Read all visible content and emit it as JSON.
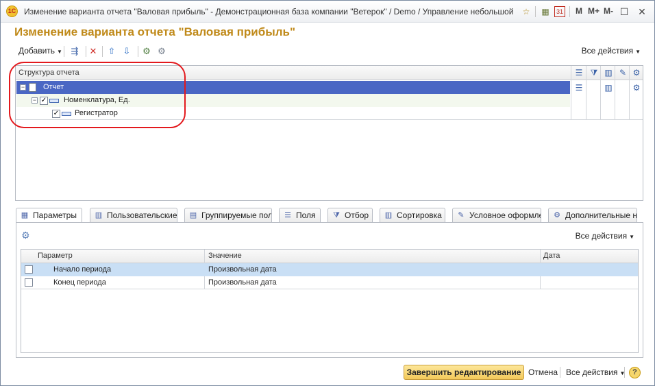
{
  "window": {
    "app_logo": "1С",
    "title": "Изменение варианта отчета \"Валовая прибыль\" - Демонстрационная база компании \"Ветерок\" / Demo / Управление небольшой фирмой,...",
    "title_buttons": {
      "m": "M",
      "m_plus": "M+",
      "m_minus": "M-",
      "minimize": "—",
      "maximize": "☐",
      "close": "✕"
    },
    "calendar_day": "31"
  },
  "page": {
    "title": "Изменение варианта отчета \"Валовая прибыль\""
  },
  "toolbar": {
    "add_label": "Добавить",
    "all_actions": "Все действия"
  },
  "structure": {
    "header": "Структура отчета",
    "rows": [
      {
        "label": "Отчет",
        "level": 0,
        "checked": null,
        "selected": true
      },
      {
        "label": "Номенклатура, Ед.",
        "level": 1,
        "checked": true,
        "selected": false
      },
      {
        "label": "Регистратор",
        "level": 2,
        "checked": true,
        "selected": false
      }
    ]
  },
  "tabs": [
    {
      "label": "Параметры",
      "active": true,
      "icon": "params-icon"
    },
    {
      "label": "Пользовательские",
      "active": false,
      "icon": "user-fields-icon"
    },
    {
      "label": "Группируемые поля",
      "active": false,
      "icon": "grouping-fields-icon"
    },
    {
      "label": "Поля",
      "active": false,
      "icon": "fields-icon"
    },
    {
      "label": "Отбор",
      "active": false,
      "icon": "filter-icon"
    },
    {
      "label": "Сортировка",
      "active": false,
      "icon": "sort-icon"
    },
    {
      "label": "Условное оформлен",
      "active": false,
      "icon": "conditional-format-icon"
    },
    {
      "label": "Дополнительные на",
      "active": false,
      "icon": "extra-settings-icon"
    }
  ],
  "params": {
    "all_actions": "Все действия",
    "columns": {
      "param": "Параметр",
      "value": "Значение",
      "date": "Дата"
    },
    "rows": [
      {
        "name": "Начало периода",
        "value": "Произвольная дата",
        "date": "",
        "checked": false,
        "selected": true
      },
      {
        "name": "Конец периода",
        "value": "Произвольная дата",
        "date": "",
        "checked": false,
        "selected": false
      }
    ]
  },
  "footer": {
    "finish_label": "Завершить редактирование",
    "cancel_label": "Отмена",
    "all_actions": "Все действия",
    "help": "?"
  },
  "colors": {
    "title_accent": "#c08a1a",
    "selection": "#4a67c4",
    "param_selection": "#c9dff5",
    "highlight_oval": "#e3191d",
    "finish_button": "#f3c95a"
  }
}
